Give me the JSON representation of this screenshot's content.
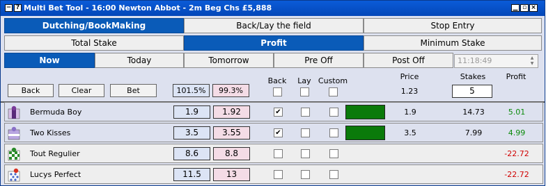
{
  "window": {
    "title": "Multi Bet Tool - 16:00  Newton Abbot - 2m Beg Chs  £5,888",
    "help_glyph": "?",
    "menu_glyph": "−"
  },
  "tabs_row1": [
    "Dutching/BookMaking",
    "Back/Lay the field",
    "Stop Entry"
  ],
  "tabs_row2": [
    "Total Stake",
    "Profit",
    "Minimum Stake"
  ],
  "tabs_row3": [
    "Now",
    "Today",
    "Tomorrow",
    "Pre Off",
    "Post Off"
  ],
  "time_value": "11:18:49",
  "toolbar": {
    "back_label": "Back",
    "clear_label": "Clear",
    "bet_label": "Bet",
    "book_back": "101.5%",
    "book_lay": "99.3%"
  },
  "columns": {
    "back": "Back",
    "lay": "Lay",
    "custom": "Custom",
    "price": "Price",
    "stakes": "Stakes",
    "profit": "Profit"
  },
  "global": {
    "price": "1.23",
    "stakes": "5"
  },
  "runners": [
    {
      "name": "Bermuda Boy",
      "back_odds": "1.9",
      "lay_odds": "1.92",
      "back": true,
      "lay": false,
      "custom": false,
      "price": "1.9",
      "stake": "14.73",
      "profit": "5.01"
    },
    {
      "name": "Two Kisses",
      "back_odds": "3.5",
      "lay_odds": "3.55",
      "back": true,
      "lay": false,
      "custom": false,
      "price": "3.5",
      "stake": "7.99",
      "profit": "4.99"
    },
    {
      "name": "Tout Regulier",
      "back_odds": "8.6",
      "lay_odds": "8.8",
      "back": false,
      "lay": false,
      "custom": false,
      "price": "",
      "stake": "",
      "profit": "-22.72"
    },
    {
      "name": "Lucys Perfect",
      "back_odds": "11.5",
      "lay_odds": "13",
      "back": false,
      "lay": false,
      "custom": false,
      "price": "",
      "stake": "",
      "profit": "-22.72"
    }
  ],
  "colors": {
    "selected_tab": "#0a5bb8",
    "profit_positive": "#0a8a0a",
    "profit_negative": "#d00000",
    "back_odds_bg": "#dce4f5",
    "lay_odds_bg": "#f4dce6",
    "stake_bar": "#0a7a0a"
  }
}
